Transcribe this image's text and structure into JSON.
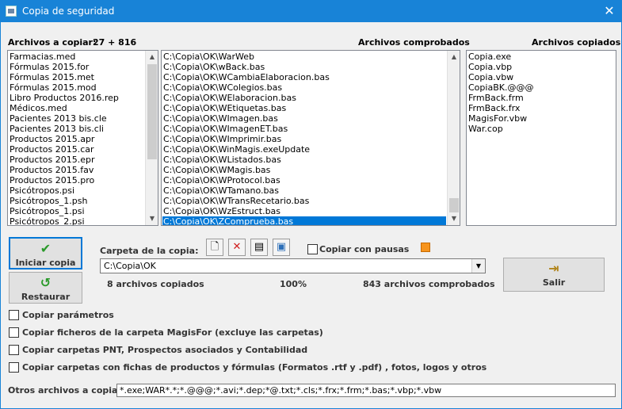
{
  "window": {
    "title": "Copia de seguridad"
  },
  "headers": {
    "to_copy_label": "Archivos a copiar:",
    "to_copy_count": "27 + 816",
    "checked": "Archivos comprobados",
    "copied": "Archivos copiados"
  },
  "files_to_copy": [
    "Farmacias.med",
    "Fórmulas 2015.for",
    "Fórmulas 2015.met",
    "Fórmulas 2015.mod",
    "Libro Productos 2016.rep",
    "Médicos.med",
    "Pacientes 2013 bis.cle",
    "Pacientes 2013 bis.cli",
    "Productos 2015.apr",
    "Productos 2015.car",
    "Productos 2015.epr",
    "Productos 2015.fav",
    "Productos 2015.pro",
    "Psicótropos.psi",
    "Psicótropos_1.psh",
    "Psicótropos_1.psi",
    "Psicótropos_2.psi"
  ],
  "checked_files": [
    "C:\\Copia\\OK\\WarWeb",
    "C:\\Copia\\OK\\wBack.bas",
    "C:\\Copia\\OK\\WCambiaElaboracion.bas",
    "C:\\Copia\\OK\\WColegios.bas",
    "C:\\Copia\\OK\\WElaboracion.bas",
    "C:\\Copia\\OK\\WEtiquetas.bas",
    "C:\\Copia\\OK\\WImagen.bas",
    "C:\\Copia\\OK\\WImagenET.bas",
    "C:\\Copia\\OK\\WImprimir.bas",
    "C:\\Copia\\OK\\WinMagis.exeUpdate",
    "C:\\Copia\\OK\\WListados.bas",
    "C:\\Copia\\OK\\WMagis.bas",
    "C:\\Copia\\OK\\WProtocol.bas",
    "C:\\Copia\\OK\\WTamano.bas",
    "C:\\Copia\\OK\\WTransRecetario.bas",
    "C:\\Copia\\OK\\WzEstruct.bas",
    "C:\\Copia\\OK\\ZComprueba.bas"
  ],
  "copied_files": [
    "Copia.exe",
    "Copia.vbp",
    "Copia.vbw",
    "CopiaBK.@@@",
    "FrmBack.frm",
    "FrmBack.frx",
    "MagisFor.vbw",
    "War.cop"
  ],
  "buttons": {
    "start": "Iniciar copia",
    "restore": "Restaurar",
    "exit": "Salir"
  },
  "folder": {
    "label": "Carpeta de la copia:",
    "value": "C:\\Copia\\OK",
    "pause_label": "Copiar con pausas"
  },
  "status": {
    "copied": "8 archivos copiados",
    "percent": "100%",
    "checked": "843 archivos comprobados"
  },
  "options": [
    "Copiar parámetros",
    "Copiar ficheros de la carpeta MagisFor (excluye las carpetas)",
    "Copiar carpetas PNT, Prospectos asociados y Contabilidad",
    "Copiar carpetas con fichas de productos y fórmulas (Formatos .rtf y .pdf) , fotos, logos y otros"
  ],
  "other_files": {
    "label": "Otros archivos a copiar:",
    "value": "*.exe;WAR*.*;*.@@@;*.avi;*.dep;*@.txt;*.cls;*.frx;*.frm;*.bas;*.vbp;*.vbw"
  },
  "colors": {
    "titlebar": "#1883d7",
    "selection": "#0078d7",
    "indicator": "#f7941d"
  }
}
